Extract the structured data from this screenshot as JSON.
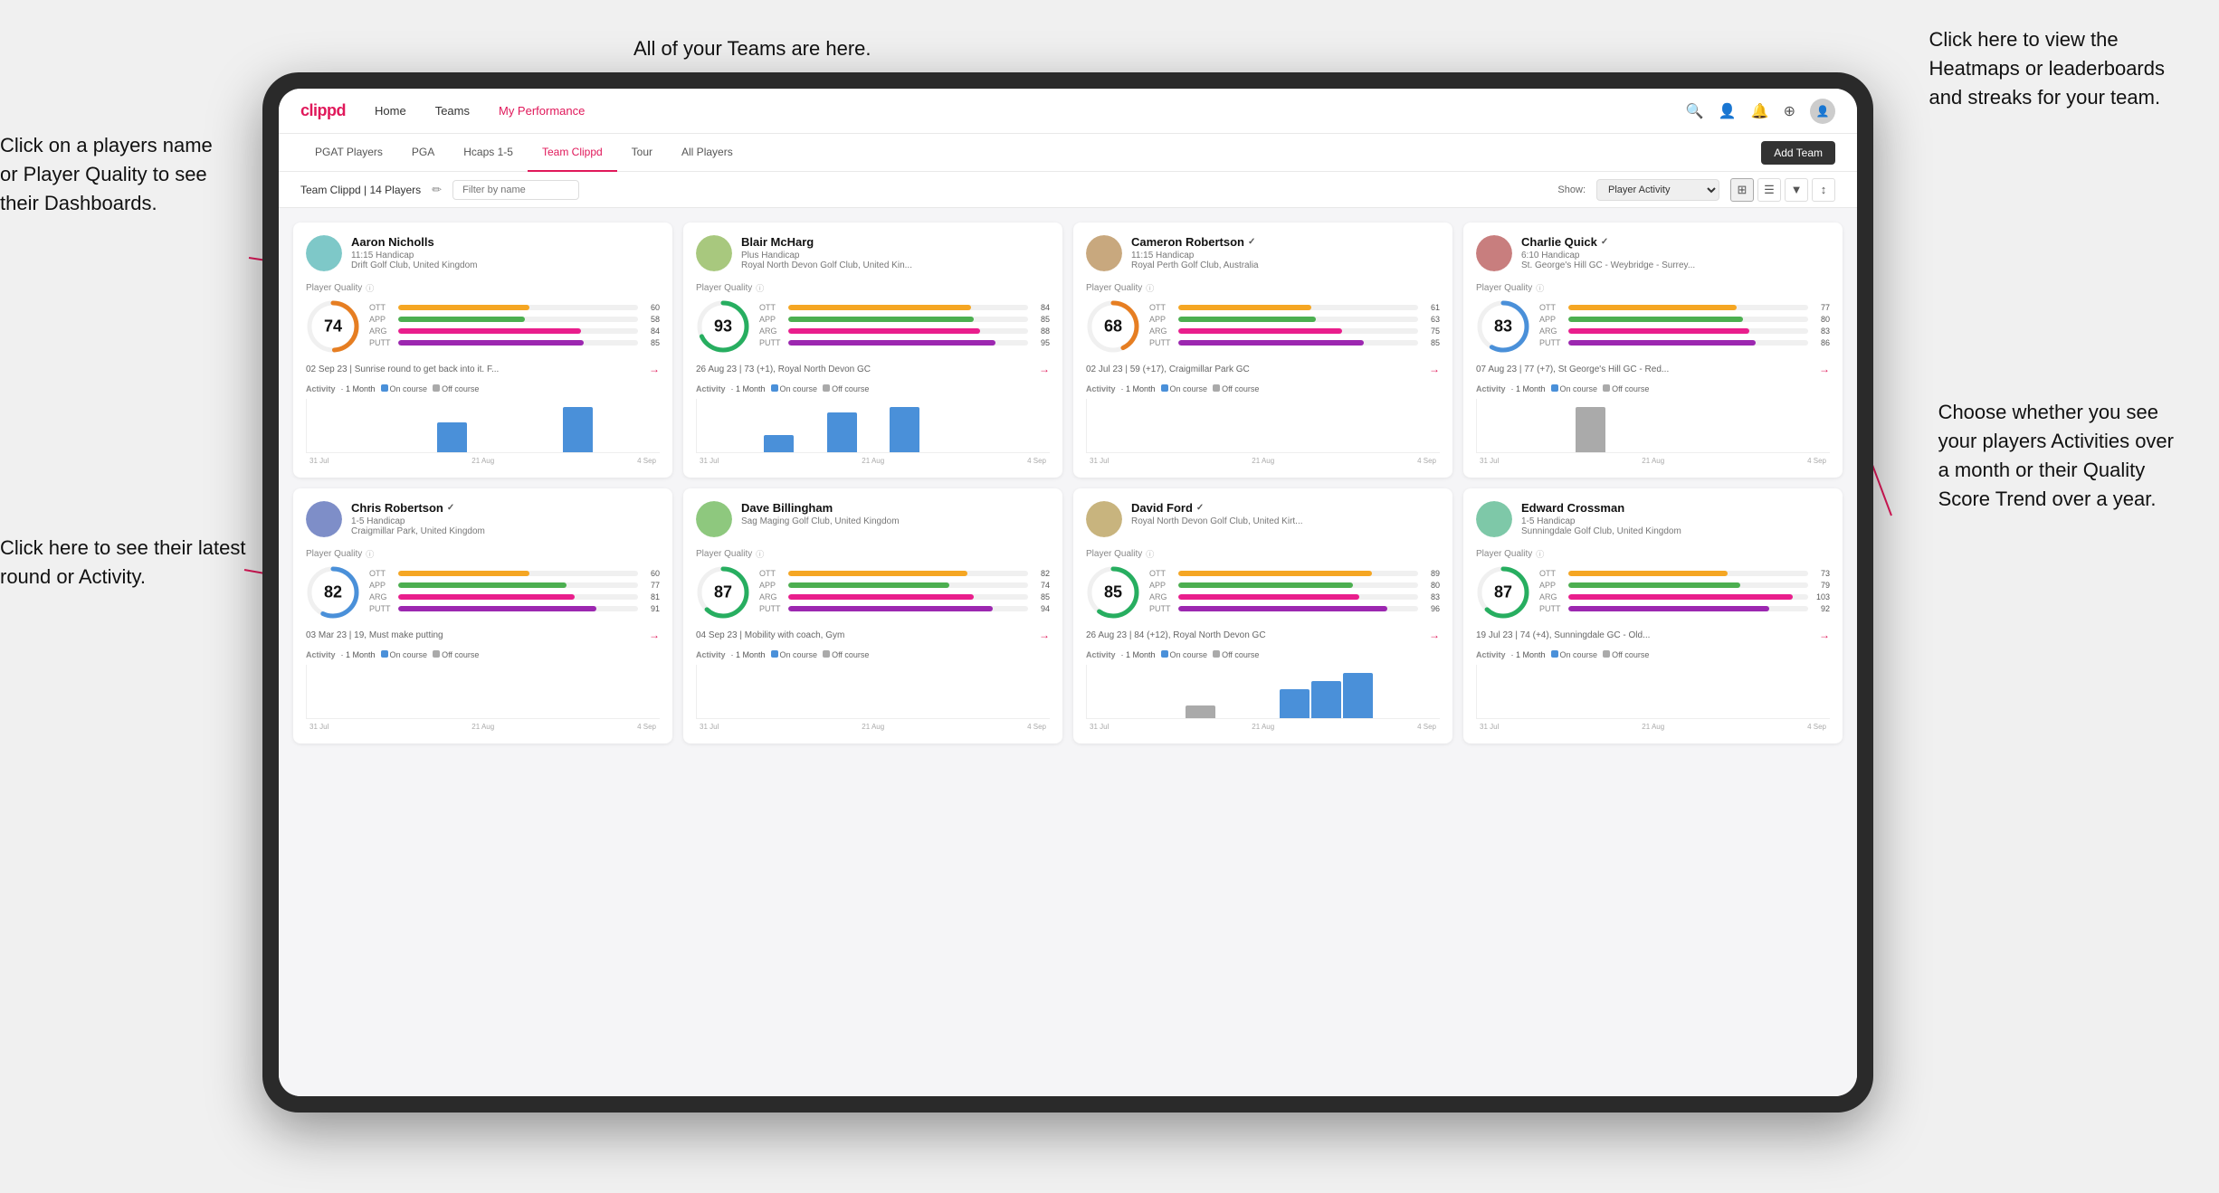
{
  "annotations": {
    "top_center": "All of your Teams are here.",
    "top_right_title": "Click here to view the",
    "top_right_line2": "Heatmaps or leaderboards",
    "top_right_line3": "and streaks for your team.",
    "left_top_title": "Click on a players name",
    "left_top_line2": "or Player Quality to see",
    "left_top_line3": "their Dashboards.",
    "left_bottom_title": "Click here to see their latest",
    "left_bottom_line2": "round or Activity.",
    "bottom_right_title": "Choose whether you see",
    "bottom_right_line2": "your players Activities over",
    "bottom_right_line3": "a month or their Quality",
    "bottom_right_line4": "Score Trend over a year."
  },
  "nav": {
    "logo": "clippd",
    "items": [
      "Home",
      "Teams",
      "My Performance"
    ],
    "icons": [
      "🔍",
      "👤",
      "🔔",
      "⊕",
      "👤"
    ]
  },
  "subnav": {
    "items": [
      "PGAT Players",
      "PGA",
      "Hcaps 1-5",
      "Team Clippd",
      "Tour",
      "All Players"
    ],
    "active": "Team Clippd",
    "add_team": "Add Team"
  },
  "teambar": {
    "title": "Team Clippd | 14 Players",
    "search_placeholder": "Filter by name",
    "show_label": "Show:",
    "show_value": "Player Activity",
    "view_icons": [
      "⊞",
      "⊟",
      "▼",
      "↕"
    ]
  },
  "players": [
    {
      "name": "Aaron Nicholls",
      "handicap": "11:15 Handicap",
      "club": "Drift Golf Club, United Kingdom",
      "quality": 74,
      "quality_color": "#4a90d9",
      "stats": [
        {
          "label": "OTT",
          "value": 60,
          "color": "#f5a623"
        },
        {
          "label": "APP",
          "value": 58,
          "color": "#7ed321"
        },
        {
          "label": "ARG",
          "value": 84,
          "color": "#e0185a"
        },
        {
          "label": "PUTT",
          "value": 85,
          "color": "#9b59b6"
        }
      ],
      "latest_round": "02 Sep 23 | Sunrise round to get back into it. F...",
      "activity_bars": [
        0,
        0,
        0,
        0,
        20,
        0,
        0,
        0,
        30,
        0,
        0
      ],
      "chart_labels": [
        "31 Jul",
        "21 Aug",
        "4 Sep"
      ]
    },
    {
      "name": "Blair McHarg",
      "handicap": "Plus Handicap",
      "club": "Royal North Devon Golf Club, United Kin...",
      "quality": 93,
      "quality_color": "#27ae60",
      "stats": [
        {
          "label": "OTT",
          "value": 84,
          "color": "#f5a623"
        },
        {
          "label": "APP",
          "value": 85,
          "color": "#7ed321"
        },
        {
          "label": "ARG",
          "value": 88,
          "color": "#e0185a"
        },
        {
          "label": "PUTT",
          "value": 95,
          "color": "#9b59b6"
        }
      ],
      "latest_round": "26 Aug 23 | 73 (+1), Royal North Devon GC",
      "activity_bars": [
        0,
        0,
        15,
        0,
        35,
        0,
        40,
        0,
        0,
        0,
        0
      ],
      "chart_labels": [
        "31 Jul",
        "21 Aug",
        "4 Sep"
      ]
    },
    {
      "name": "Cameron Robertson",
      "verified": true,
      "handicap": "11:15 Handicap",
      "club": "Royal Perth Golf Club, Australia",
      "quality": 68,
      "quality_color": "#e67e22",
      "stats": [
        {
          "label": "OTT",
          "value": 61,
          "color": "#f5a623"
        },
        {
          "label": "APP",
          "value": 63,
          "color": "#7ed321"
        },
        {
          "label": "ARG",
          "value": 75,
          "color": "#e0185a"
        },
        {
          "label": "PUTT",
          "value": 85,
          "color": "#9b59b6"
        }
      ],
      "latest_round": "02 Jul 23 | 59 (+17), Craigmillar Park GC",
      "activity_bars": [
        0,
        0,
        0,
        0,
        0,
        0,
        0,
        0,
        0,
        0,
        0
      ],
      "chart_labels": [
        "31 Jul",
        "21 Aug",
        "4 Sep"
      ]
    },
    {
      "name": "Charlie Quick",
      "verified": true,
      "handicap": "6:10 Handicap",
      "club": "St. George's Hill GC - Weybridge - Surrey...",
      "quality": 83,
      "quality_color": "#27ae60",
      "stats": [
        {
          "label": "OTT",
          "value": 77,
          "color": "#f5a623"
        },
        {
          "label": "APP",
          "value": 80,
          "color": "#7ed321"
        },
        {
          "label": "ARG",
          "value": 83,
          "color": "#e0185a"
        },
        {
          "label": "PUTT",
          "value": 86,
          "color": "#9b59b6"
        }
      ],
      "latest_round": "07 Aug 23 | 77 (+7), St George's Hill GC - Red...",
      "activity_bars": [
        0,
        0,
        0,
        20,
        0,
        0,
        0,
        0,
        0,
        0,
        0
      ],
      "chart_labels": [
        "31 Jul",
        "21 Aug",
        "4 Sep"
      ]
    },
    {
      "name": "Chris Robertson",
      "verified": true,
      "handicap": "1-5 Handicap",
      "club": "Craigmillar Park, United Kingdom",
      "quality": 82,
      "quality_color": "#27ae60",
      "stats": [
        {
          "label": "OTT",
          "value": 60,
          "color": "#f5a623"
        },
        {
          "label": "APP",
          "value": 77,
          "color": "#7ed321"
        },
        {
          "label": "ARG",
          "value": 81,
          "color": "#e0185a"
        },
        {
          "label": "PUTT",
          "value": 91,
          "color": "#9b59b6"
        }
      ],
      "latest_round": "03 Mar 23 | 19, Must make putting",
      "activity_bars": [
        0,
        0,
        0,
        0,
        0,
        0,
        0,
        0,
        0,
        0,
        0
      ],
      "chart_labels": [
        "31 Jul",
        "21 Aug",
        "4 Sep"
      ]
    },
    {
      "name": "Dave Billingham",
      "handicap": "",
      "club": "Sag Maging Golf Club, United Kingdom",
      "quality": 87,
      "quality_color": "#27ae60",
      "stats": [
        {
          "label": "OTT",
          "value": 82,
          "color": "#f5a623"
        },
        {
          "label": "APP",
          "value": 74,
          "color": "#7ed321"
        },
        {
          "label": "ARG",
          "value": 85,
          "color": "#e0185a"
        },
        {
          "label": "PUTT",
          "value": 94,
          "color": "#9b59b6"
        }
      ],
      "latest_round": "04 Sep 23 | Mobility with coach, Gym",
      "activity_bars": [
        0,
        0,
        0,
        0,
        0,
        0,
        0,
        0,
        0,
        0,
        0
      ],
      "chart_labels": [
        "31 Jul",
        "21 Aug",
        "4 Sep"
      ]
    },
    {
      "name": "David Ford",
      "verified": true,
      "handicap": "",
      "club": "Royal North Devon Golf Club, United Kirt...",
      "quality": 85,
      "quality_color": "#27ae60",
      "stats": [
        {
          "label": "OTT",
          "value": 89,
          "color": "#f5a623"
        },
        {
          "label": "APP",
          "value": 80,
          "color": "#7ed321"
        },
        {
          "label": "ARG",
          "value": 83,
          "color": "#e0185a"
        },
        {
          "label": "PUTT",
          "value": 96,
          "color": "#9b59b6"
        }
      ],
      "latest_round": "26 Aug 23 | 84 (+12), Royal North Devon GC",
      "activity_bars": [
        0,
        0,
        0,
        15,
        0,
        0,
        35,
        45,
        55,
        0,
        0
      ],
      "chart_labels": [
        "31 Jul",
        "21 Aug",
        "4 Sep"
      ]
    },
    {
      "name": "Edward Crossman",
      "handicap": "1-5 Handicap",
      "club": "Sunningdale Golf Club, United Kingdom",
      "quality": 87,
      "quality_color": "#27ae60",
      "stats": [
        {
          "label": "OTT",
          "value": 73,
          "color": "#f5a623"
        },
        {
          "label": "APP",
          "value": 79,
          "color": "#7ed321"
        },
        {
          "label": "ARG",
          "value": 103,
          "color": "#e0185a"
        },
        {
          "label": "PUTT",
          "value": 92,
          "color": "#9b59b6"
        }
      ],
      "latest_round": "19 Jul 23 | 74 (+4), Sunningdale GC - Old...",
      "activity_bars": [
        0,
        0,
        0,
        0,
        0,
        0,
        0,
        0,
        0,
        0,
        0
      ],
      "chart_labels": [
        "31 Jul",
        "21 Aug",
        "4 Sep"
      ]
    }
  ],
  "activity": {
    "title": "Activity",
    "period": "1 Month",
    "on_course": "On course",
    "off_course": "Off course",
    "dot_on_color": "#4a90d9",
    "dot_off_color": "#aaa"
  }
}
